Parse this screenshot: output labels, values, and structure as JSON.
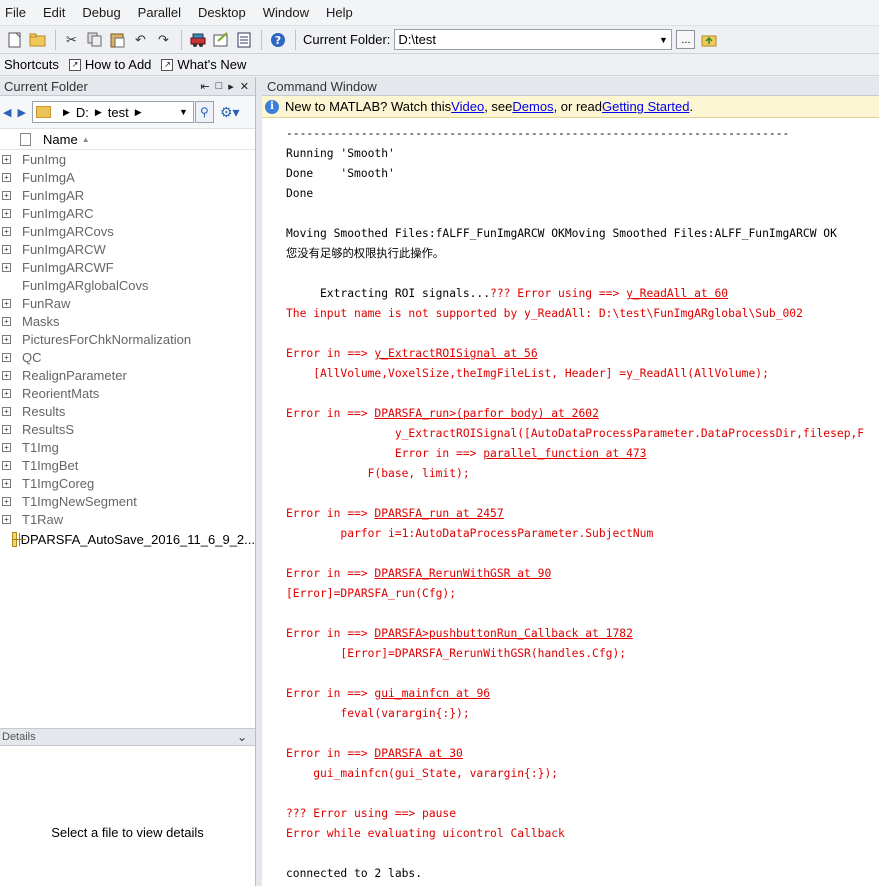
{
  "menu": [
    "File",
    "Edit",
    "Debug",
    "Parallel",
    "Desktop",
    "Window",
    "Help"
  ],
  "toolbar": {
    "current_folder_label": "Current Folder:",
    "current_folder_value": "D:\\test",
    "browse_label": "..."
  },
  "shortcuts": [
    {
      "label": "Shortcuts"
    },
    {
      "label": "How to Add"
    },
    {
      "label": "What's New"
    }
  ],
  "left_panel": {
    "title": "Current Folder",
    "path_drive": "D:",
    "path_folder": "test",
    "name_column": "Name",
    "items": [
      {
        "name": "FunImg",
        "expandable": true
      },
      {
        "name": "FunImgA",
        "expandable": true
      },
      {
        "name": "FunImgAR",
        "expandable": true
      },
      {
        "name": "FunImgARC",
        "expandable": true
      },
      {
        "name": "FunImgARCovs",
        "expandable": true
      },
      {
        "name": "FunImgARCW",
        "expandable": true
      },
      {
        "name": "FunImgARCWF",
        "expandable": true
      },
      {
        "name": "FunImgARglobalCovs",
        "expandable": false
      },
      {
        "name": "FunRaw",
        "expandable": true
      },
      {
        "name": "Masks",
        "expandable": true
      },
      {
        "name": "PicturesForChkNormalization",
        "expandable": true
      },
      {
        "name": "QC",
        "expandable": true
      },
      {
        "name": "RealignParameter",
        "expandable": true
      },
      {
        "name": "ReorientMats",
        "expandable": true
      },
      {
        "name": "Results",
        "expandable": true
      },
      {
        "name": "ResultsS",
        "expandable": true
      },
      {
        "name": "T1Img",
        "expandable": true
      },
      {
        "name": "T1ImgBet",
        "expandable": true
      },
      {
        "name": "T1ImgCoreg",
        "expandable": true
      },
      {
        "name": "T1ImgNewSegment",
        "expandable": true
      },
      {
        "name": "T1Raw",
        "expandable": true
      }
    ],
    "mat_file": "DPARSFA_AutoSave_2016_11_6_9_2...",
    "details_title": "Details",
    "details_message": "Select a file to view details"
  },
  "command_window": {
    "title": "Command Window",
    "info_prefix": "New to MATLAB? Watch this ",
    "info_video": "Video",
    "info_mid1": ", see ",
    "info_demos": "Demos",
    "info_mid2": ", or read ",
    "info_getting_started": "Getting Started",
    "info_suffix": ".",
    "lines": [
      [
        {
          "t": "--------------------------------------------------------------------------",
          "c": "blk"
        }
      ],
      [
        {
          "t": "Running 'Smooth'",
          "c": "blk"
        }
      ],
      [
        {
          "t": "Done    'Smooth'",
          "c": "blk"
        }
      ],
      [
        {
          "t": "Done",
          "c": "blk"
        }
      ],
      [
        {
          "t": "",
          "c": "blk"
        }
      ],
      [
        {
          "t": "Moving Smoothed Files:fALFF_FunImgARCW OKMoving Smoothed Files:ALFF_FunImgARCW OK",
          "c": "blk"
        }
      ],
      [
        {
          "t": "您没有足够的权限执行此操作。",
          "c": "blk"
        }
      ],
      [
        {
          "t": "",
          "c": "blk"
        }
      ],
      [
        {
          "t": "     Extracting ROI signals...",
          "c": "blk"
        },
        {
          "t": "??? Error using ==> ",
          "c": "red"
        },
        {
          "t": "y_ReadAll at 60",
          "c": "lnk"
        }
      ],
      [
        {
          "t": "The input name is not supported by y_ReadAll: D:\\test\\FunImgARglobal\\Sub_002",
          "c": "red"
        }
      ],
      [
        {
          "t": "",
          "c": "blk"
        }
      ],
      [
        {
          "t": "Error in ==> ",
          "c": "red"
        },
        {
          "t": "y_ExtractROISignal at 56",
          "c": "lnk"
        }
      ],
      [
        {
          "t": "    [AllVolume,VoxelSize,theImgFileList, Header] =y_ReadAll(AllVolume);",
          "c": "red"
        }
      ],
      [
        {
          "t": "",
          "c": "blk"
        }
      ],
      [
        {
          "t": "Error in ==> ",
          "c": "red"
        },
        {
          "t": "DPARSFA_run>(parfor body) at 2602",
          "c": "lnk"
        }
      ],
      [
        {
          "t": "                y_ExtractROISignal([AutoDataProcessParameter.DataProcessDir,filesep,F",
          "c": "red"
        }
      ],
      [
        {
          "t": "                Error in ==> ",
          "c": "red"
        },
        {
          "t": "parallel_function at 473",
          "c": "lnk"
        }
      ],
      [
        {
          "t": "            F(base, limit);",
          "c": "red"
        }
      ],
      [
        {
          "t": "",
          "c": "blk"
        }
      ],
      [
        {
          "t": "Error in ==> ",
          "c": "red"
        },
        {
          "t": "DPARSFA_run at 2457",
          "c": "lnk"
        }
      ],
      [
        {
          "t": "        parfor i=1:AutoDataProcessParameter.SubjectNum",
          "c": "red"
        }
      ],
      [
        {
          "t": "",
          "c": "blk"
        }
      ],
      [
        {
          "t": "Error in ==> ",
          "c": "red"
        },
        {
          "t": "DPARSFA_RerunWithGSR at 90",
          "c": "lnk"
        }
      ],
      [
        {
          "t": "[Error]=DPARSFA_run(Cfg);",
          "c": "red"
        }
      ],
      [
        {
          "t": "",
          "c": "blk"
        }
      ],
      [
        {
          "t": "Error in ==> ",
          "c": "red"
        },
        {
          "t": "DPARSFA>pushbuttonRun_Callback at 1782",
          "c": "lnk"
        }
      ],
      [
        {
          "t": "        [Error]=DPARSFA_RerunWithGSR(handles.Cfg);",
          "c": "red"
        }
      ],
      [
        {
          "t": "",
          "c": "blk"
        }
      ],
      [
        {
          "t": "Error in ==> ",
          "c": "red"
        },
        {
          "t": "gui_mainfcn at 96",
          "c": "lnk"
        }
      ],
      [
        {
          "t": "        feval(varargin{:});",
          "c": "red"
        }
      ],
      [
        {
          "t": "",
          "c": "blk"
        }
      ],
      [
        {
          "t": "Error in ==> ",
          "c": "red"
        },
        {
          "t": "DPARSFA at 30",
          "c": "lnk"
        }
      ],
      [
        {
          "t": "    gui_mainfcn(gui_State, varargin{:});",
          "c": "red"
        }
      ],
      [
        {
          "t": "",
          "c": "blk"
        }
      ],
      [
        {
          "t": "??? Error using ==> pause",
          "c": "red"
        }
      ],
      [
        {
          "t": "Error while evaluating uicontrol Callback",
          "c": "red"
        }
      ],
      [
        {
          "t": "",
          "c": "blk"
        }
      ],
      [
        {
          "t": "connected to 2 labs.",
          "c": "blk"
        }
      ]
    ]
  }
}
